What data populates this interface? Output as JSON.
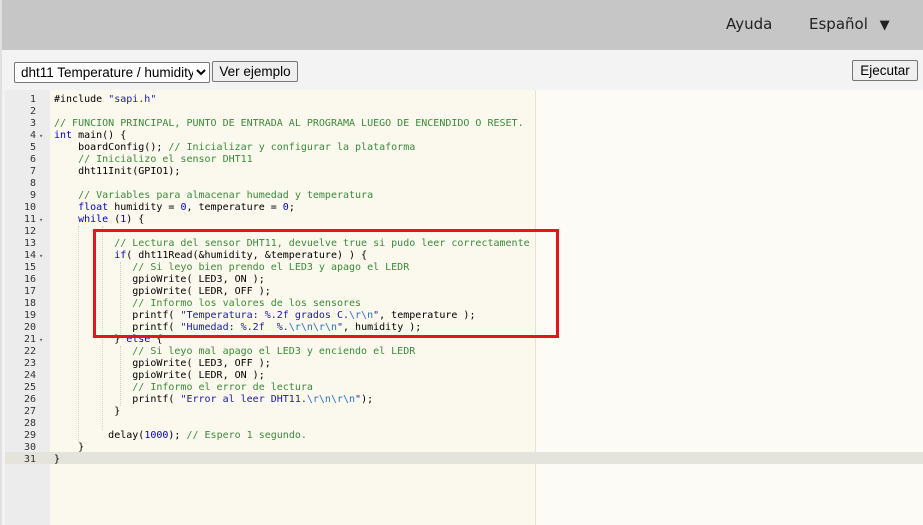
{
  "nav": {
    "help_label": "Ayuda",
    "language_label": "Español",
    "language_arrow": "▼"
  },
  "toolbar": {
    "example_selected": "dht11 Temperature / humidity",
    "example_options": [
      "dht11 Temperature / humidity"
    ],
    "load_example_label": "Ver ejemplo",
    "run_label": "Ejecutar"
  },
  "editor": {
    "active_line": 31,
    "highlighted_lines": [
      13,
      20
    ],
    "lines": [
      {
        "n": "1",
        "fold": "",
        "code": [
          [
            "pp",
            "#include "
          ],
          [
            "str",
            "\"sapi.h\""
          ]
        ]
      },
      {
        "n": "2",
        "fold": "",
        "code": []
      },
      {
        "n": "3",
        "fold": "",
        "code": [
          [
            "cm",
            "// FUNCION PRINCIPAL, PUNTO DE ENTRADA AL PROGRAMA LUEGO DE ENCENDIDO O RESET."
          ]
        ]
      },
      {
        "n": "4",
        "fold": "▾",
        "code": [
          [
            "kw",
            "int"
          ],
          [
            "tx",
            " main() {"
          ]
        ]
      },
      {
        "n": "5",
        "fold": "",
        "code": [
          [
            "tx",
            "    boardConfig(); "
          ],
          [
            "cm",
            "// Inicializar y configurar la plataforma"
          ]
        ]
      },
      {
        "n": "6",
        "fold": "",
        "code": [
          [
            "cm",
            "    // Inicializo el sensor DHT11"
          ]
        ]
      },
      {
        "n": "7",
        "fold": "",
        "code": [
          [
            "tx",
            "    dht11Init(GPIO1);"
          ]
        ]
      },
      {
        "n": "8",
        "fold": "",
        "code": []
      },
      {
        "n": "9",
        "fold": "",
        "code": [
          [
            "cm",
            "    // Variables para almacenar humedad y temperatura"
          ]
        ]
      },
      {
        "n": "10",
        "fold": "",
        "code": [
          [
            "kw",
            "    float"
          ],
          [
            "tx",
            " humidity = "
          ],
          [
            "num",
            "0"
          ],
          [
            "tx",
            ", temperature = "
          ],
          [
            "num",
            "0"
          ],
          [
            "tx",
            ";"
          ]
        ]
      },
      {
        "n": "11",
        "fold": "▾",
        "code": [
          [
            "kw",
            "    while"
          ],
          [
            "tx",
            " ("
          ],
          [
            "num",
            "1"
          ],
          [
            "tx",
            ") {"
          ]
        ]
      },
      {
        "n": "12",
        "fold": "",
        "code": []
      },
      {
        "n": "13",
        "fold": "",
        "code": [
          [
            "cm",
            "          // Lectura del sensor DHT11, devuelve true si pudo leer correctamente"
          ]
        ]
      },
      {
        "n": "14",
        "fold": "▾",
        "code": [
          [
            "kw",
            "          if"
          ],
          [
            "tx",
            "( dht11Read(&humidity, &temperature) ) {"
          ]
        ]
      },
      {
        "n": "15",
        "fold": "",
        "code": [
          [
            "cm",
            "             // Si leyo bien prendo el LED3 y apago el LEDR"
          ]
        ]
      },
      {
        "n": "16",
        "fold": "",
        "code": [
          [
            "tx",
            "             gpioWrite( LED3, ON );"
          ]
        ]
      },
      {
        "n": "17",
        "fold": "",
        "code": [
          [
            "tx",
            "             gpioWrite( LEDR, OFF );"
          ]
        ]
      },
      {
        "n": "18",
        "fold": "",
        "code": [
          [
            "cm",
            "             // Informo los valores de los sensores"
          ]
        ]
      },
      {
        "n": "19",
        "fold": "",
        "code": [
          [
            "tx",
            "             printf( "
          ],
          [
            "str",
            "\"Temperatura: %.2f grados C."
          ],
          [
            "esc",
            "\\r\\n"
          ],
          [
            "str",
            "\""
          ],
          [
            "tx",
            ", temperature );"
          ]
        ]
      },
      {
        "n": "20",
        "fold": "",
        "code": [
          [
            "tx",
            "             printf( "
          ],
          [
            "str",
            "\"Humedad: %.2f  %."
          ],
          [
            "esc",
            "\\r\\n\\r\\n"
          ],
          [
            "str",
            "\""
          ],
          [
            "tx",
            ", humidity );"
          ]
        ]
      },
      {
        "n": "21",
        "fold": "▾",
        "code": [
          [
            "tx",
            "          } "
          ],
          [
            "kw",
            "else"
          ],
          [
            "tx",
            " {"
          ]
        ]
      },
      {
        "n": "22",
        "fold": "",
        "code": [
          [
            "cm",
            "             // Si leyo mal apago el LED3 y enciendo el LEDR"
          ]
        ]
      },
      {
        "n": "23",
        "fold": "",
        "code": [
          [
            "tx",
            "             gpioWrite( LED3, OFF );"
          ]
        ]
      },
      {
        "n": "24",
        "fold": "",
        "code": [
          [
            "tx",
            "             gpioWrite( LEDR, ON );"
          ]
        ]
      },
      {
        "n": "25",
        "fold": "",
        "code": [
          [
            "cm",
            "             // Informo el error de lectura"
          ]
        ]
      },
      {
        "n": "26",
        "fold": "",
        "code": [
          [
            "tx",
            "             printf( "
          ],
          [
            "str",
            "\"Error al leer DHT11."
          ],
          [
            "esc",
            "\\r\\n\\r\\n"
          ],
          [
            "str",
            "\""
          ],
          [
            "tx",
            ");"
          ]
        ]
      },
      {
        "n": "27",
        "fold": "",
        "code": [
          [
            "tx",
            "          }"
          ]
        ]
      },
      {
        "n": "28",
        "fold": "",
        "code": []
      },
      {
        "n": "29",
        "fold": "",
        "code": [
          [
            "tx",
            "         delay("
          ],
          [
            "num",
            "1000"
          ],
          [
            "tx",
            "); "
          ],
          [
            "cm",
            "// Espero 1 segundo."
          ]
        ]
      },
      {
        "n": "30",
        "fold": "",
        "code": [
          [
            "tx",
            "    }"
          ]
        ]
      },
      {
        "n": "31",
        "fold": "",
        "code": [
          [
            "tx",
            "}"
          ]
        ]
      }
    ]
  },
  "colors": {
    "highlight_box": "#e1171d",
    "topbar": "#c6c6c6",
    "editor_bg": "#fbf8ee"
  }
}
